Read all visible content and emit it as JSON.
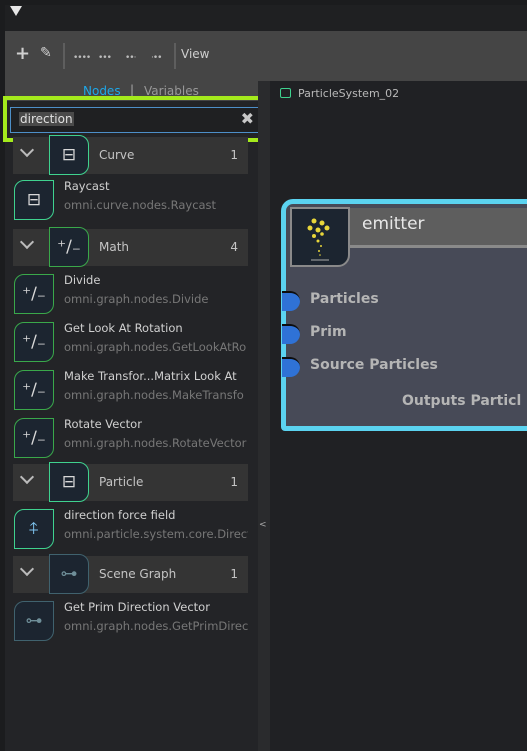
{
  "toolbar": {
    "view_label": "View",
    "icons": [
      "plus-icon",
      "pencil-icon",
      "dots-icon",
      "dots-icon",
      "dots-icon",
      "dots-icon"
    ]
  },
  "tabs": {
    "nodes": "Nodes",
    "divider": "|",
    "variables": "Variables",
    "active_color": "#1ea7e8"
  },
  "search": {
    "value": "direction",
    "highlight_color": "#a4ea1c"
  },
  "categories": [
    {
      "name": "Curve",
      "count": "1",
      "items": [
        {
          "title": "Raycast",
          "path": "omni.curve.nodes.Raycast"
        }
      ]
    },
    {
      "name": "Math",
      "count": "4",
      "items": [
        {
          "title": "Divide",
          "path": "omni.graph.nodes.Divide"
        },
        {
          "title": "Get Look At Rotation",
          "path": "omni.graph.nodes.GetLookAtRo"
        },
        {
          "title": "Make Transfor...Matrix Look At",
          "path": "omni.graph.nodes.MakeTransfo"
        },
        {
          "title": "Rotate Vector",
          "path": "omni.graph.nodes.RotateVector"
        }
      ]
    },
    {
      "name": "Particle",
      "count": "1",
      "items": [
        {
          "title": "direction force field",
          "path": "omni.particle.system.core.Direct"
        }
      ]
    },
    {
      "name": "Scene Graph",
      "count": "1",
      "items": [
        {
          "title": "Get Prim Direction Vector",
          "path": "omni.graph.nodes.GetPrimDirec"
        }
      ]
    }
  ],
  "graph": {
    "title": "ParticleSystem_02",
    "collapse_glyph": "<"
  },
  "node": {
    "title": "emitter",
    "inputs": [
      "Particles",
      "Prim",
      "Source Particles"
    ],
    "output": "Outputs Particl",
    "border_color": "#5bd3f0",
    "port_color": "#2f72d6"
  }
}
